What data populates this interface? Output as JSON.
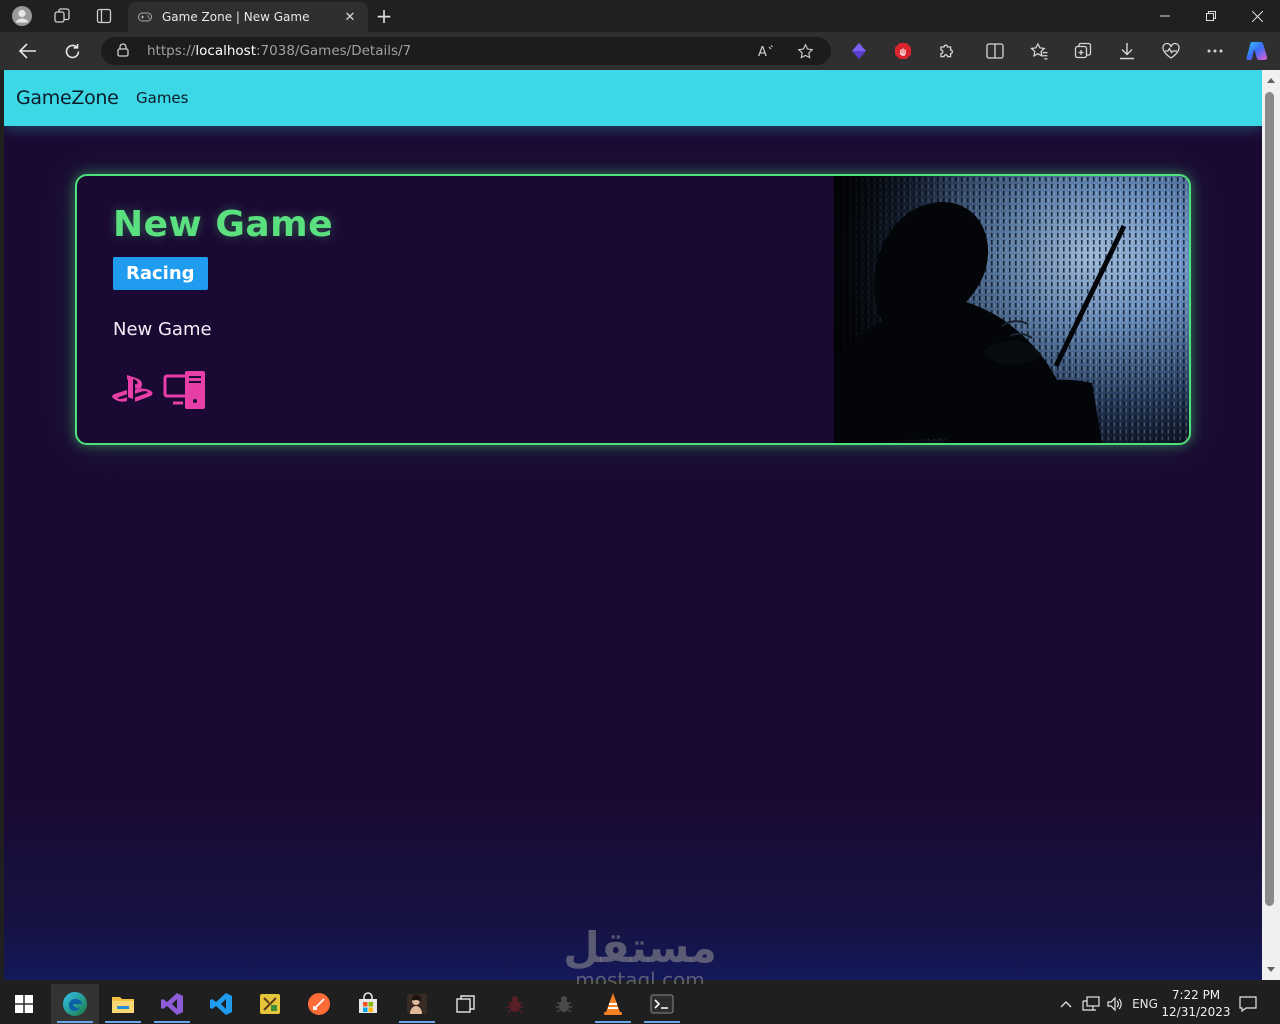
{
  "browser": {
    "tab_title": "Game Zone | New Game",
    "url_prefix": "https://",
    "url_host": "localhost",
    "url_path": ":7038/Games/Details/7",
    "tab_close_glyph": "✕",
    "new_tab_glyph": "+"
  },
  "site": {
    "brand": "GameZone",
    "nav_games": "Games",
    "accent_navbar": "#3cd8e6",
    "accent_card_border": "#4ee07a"
  },
  "game": {
    "title": "New Game",
    "category": "Racing",
    "description": "New Game",
    "platforms": [
      "playstation-icon",
      "pc-icon"
    ],
    "cover_image": "hooded-hacker-binary-code"
  },
  "watermark": {
    "arabic": "مستقل",
    "latin": "mostaql.com"
  },
  "taskbar": {
    "language": "ENG",
    "time": "7:22 PM",
    "date": "12/31/2023"
  }
}
